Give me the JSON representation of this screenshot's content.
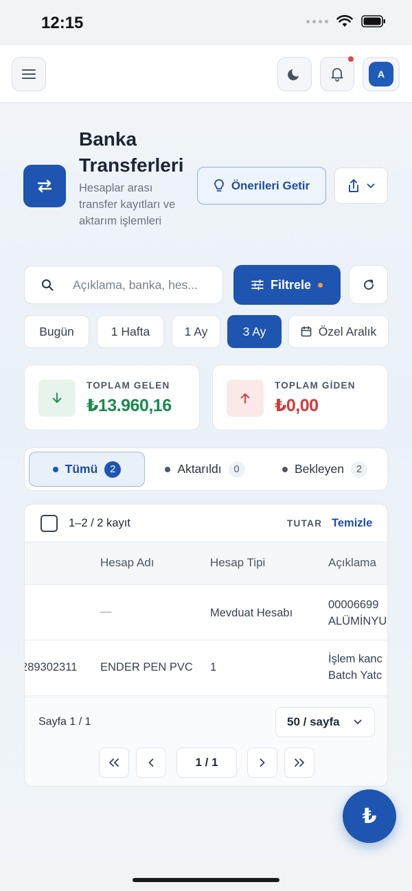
{
  "status_bar": {
    "time": "12:15"
  },
  "header": {
    "title": "Banka Transferleri",
    "subtitle": "Hesaplar arası transfer kayıtları ve aktarım işlemleri",
    "suggestions_label": "Önerileri Getir",
    "avatar_initial": "A"
  },
  "search": {
    "placeholder": "Açıklama, banka, hes..."
  },
  "filter": {
    "label": "Filtrele"
  },
  "date_ranges": [
    {
      "label": "Bugün"
    },
    {
      "label": "1 Hafta"
    },
    {
      "label": "1 Ay"
    },
    {
      "label": "3 Ay",
      "active": true
    },
    {
      "label": "Özel Aralık"
    }
  ],
  "stats": {
    "incoming": {
      "label": "TOPLAM GELEN",
      "value": "₺13.960,16",
      "color": "#1a8a4f"
    },
    "outgoing": {
      "label": "TOPLAM GİDEN",
      "value": "₺0,00",
      "color": "#d23a3a"
    }
  },
  "status_tabs": [
    {
      "label": "Tümü",
      "count": "2",
      "active": true
    },
    {
      "label": "Aktarıldı",
      "count": "0"
    },
    {
      "label": "Bekleyen",
      "count": "2"
    }
  ],
  "table": {
    "record_count": "1–2 / 2 kayıt",
    "sort_label": "TUTAR",
    "clear_label": "Temizle",
    "columns": [
      "Hesap Adı",
      "Hesap Tipi",
      "Açıklama"
    ],
    "rows": [
      {
        "prefix": "",
        "account_name": "—",
        "account_type": "Mevduat Hesabı",
        "desc_line1": "00006699",
        "desc_line2": "ALÜMİNYUM"
      },
      {
        "prefix": "289302311",
        "account_name": "ENDER PEN PVC",
        "account_type": "1",
        "desc_line1": "İşlem kanc",
        "desc_line2": "Batch Yatc"
      }
    ]
  },
  "pagination": {
    "page_label": "Sayfa 1 / 1",
    "per_page": "50 / sayfa",
    "current": "1 / 1"
  },
  "fab": {
    "symbol": "₺"
  },
  "colors": {
    "primary": "#1d55b0",
    "accent_dot": "#f39a3c",
    "notification_dot": "#e04848"
  }
}
